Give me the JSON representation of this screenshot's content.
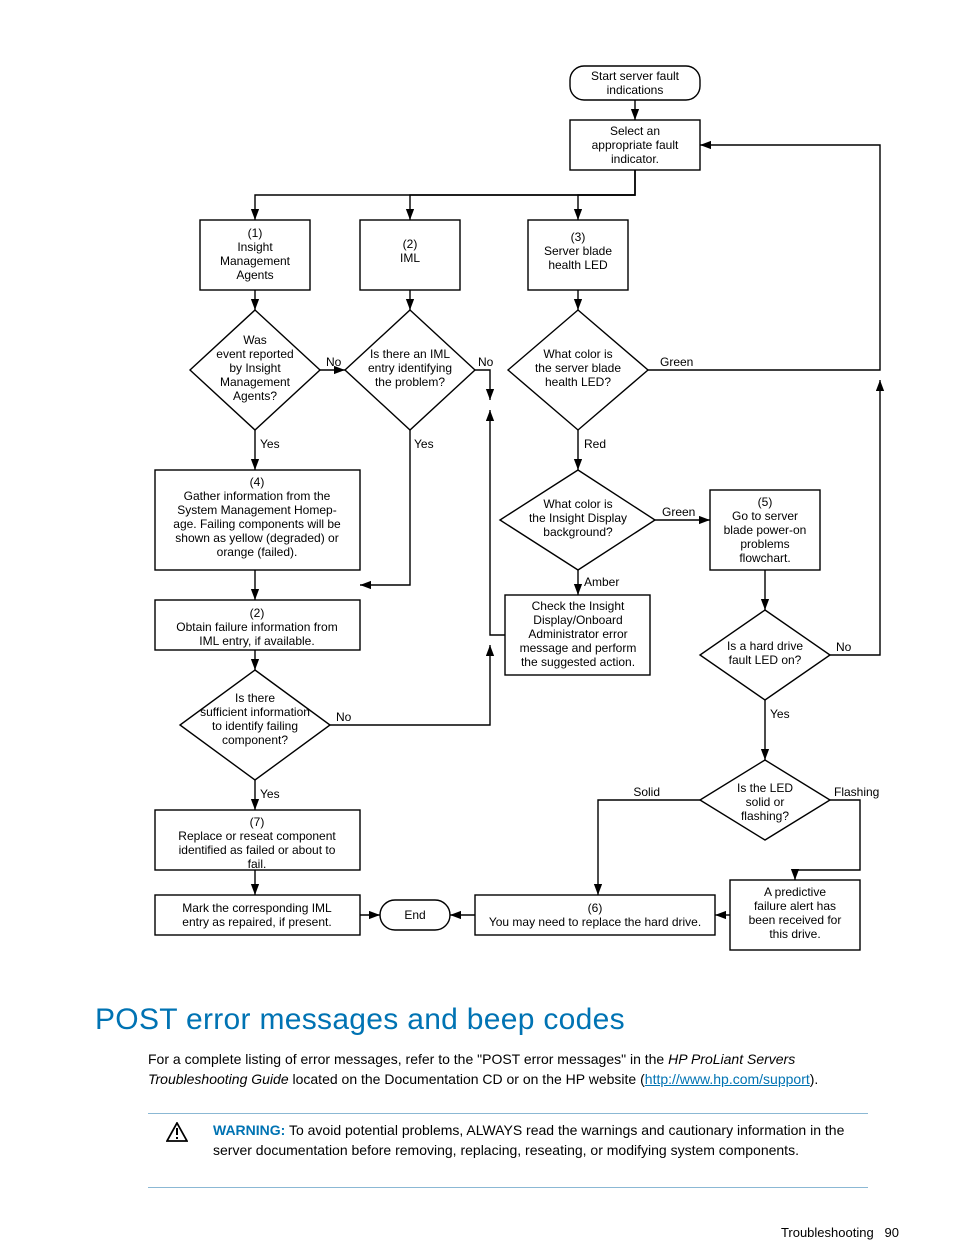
{
  "flowchart": {
    "nodes": {
      "start": {
        "lines": [
          "Start server fault",
          "indications"
        ]
      },
      "select": {
        "lines": [
          "Select an",
          "appropriate fault",
          "indicator."
        ]
      },
      "n1": {
        "lines": [
          "(1)",
          "Insight",
          "Management",
          "Agents"
        ]
      },
      "n2": {
        "lines": [
          "(2)",
          "IML"
        ]
      },
      "n3": {
        "lines": [
          "(3)",
          "Server blade",
          "health LED"
        ]
      },
      "d_was": {
        "lines": [
          "Was",
          "event reported",
          "by Insight",
          "Management",
          "Agents?"
        ]
      },
      "d_iml": {
        "lines": [
          "Is there an IML",
          "entry identifying",
          "the problem?"
        ]
      },
      "d_color_led": {
        "lines": [
          "What color is",
          "the server blade",
          "health LED?"
        ]
      },
      "n4": {
        "lines": [
          "(4)",
          "Gather information from the",
          "System Management Homep-",
          "age. Failing components will be",
          "shown as yellow (degraded) or",
          "orange (failed)."
        ]
      },
      "d_color_bg": {
        "lines": [
          "What color is",
          "the Insight Display",
          "background?"
        ]
      },
      "n5": {
        "lines": [
          "(5)",
          "Go to server",
          "blade power-on",
          "problems",
          "flowchart."
        ]
      },
      "n2b": {
        "lines": [
          "(2)",
          "Obtain failure information from",
          "IML entry, if available."
        ]
      },
      "check": {
        "lines": [
          "Check the Insight",
          "Display/Onboard",
          "Administrator error",
          "message and perform",
          "the suggested action."
        ]
      },
      "d_hd": {
        "lines": [
          "Is a hard drive",
          "fault LED on?"
        ]
      },
      "d_suff": {
        "lines": [
          "Is there",
          "sufficient information",
          "to identify failing",
          "component?"
        ]
      },
      "d_solid": {
        "lines": [
          "Is the LED",
          "solid or",
          "flashing?"
        ]
      },
      "n7": {
        "lines": [
          "(7)",
          "Replace or reseat component",
          "identified as failed or about to",
          "fail."
        ]
      },
      "mark": {
        "lines": [
          "Mark the corresponding IML",
          "entry as repaired, if present."
        ]
      },
      "end": {
        "lines": [
          "End"
        ]
      },
      "n6": {
        "lines": [
          "(6)",
          "You may need to replace the hard drive."
        ]
      },
      "pred": {
        "lines": [
          "A predictive",
          "failure alert has",
          "been received for",
          "this drive."
        ]
      }
    },
    "edges": {
      "no": "No",
      "yes": "Yes",
      "green": "Green",
      "red": "Red",
      "amber": "Amber",
      "solid": "Solid",
      "flashing": "Flashing"
    }
  },
  "heading": "POST error messages and beep codes",
  "body": {
    "t1": "For a complete listing of error messages, refer to the \"POST error messages\" in the ",
    "t2": "HP ProLiant Servers Troubleshooting Guide",
    "t3": " located on the Documentation CD or on the HP website (",
    "link": "http://www.hp.com/support",
    "t4": ")."
  },
  "warning": {
    "label": "WARNING:",
    "text": "  To avoid potential problems, ALWAYS read the warnings and cautionary information in the server documentation before removing, replacing, reseating, or modifying system components."
  },
  "footer": {
    "section": "Troubleshooting",
    "page": "90"
  }
}
